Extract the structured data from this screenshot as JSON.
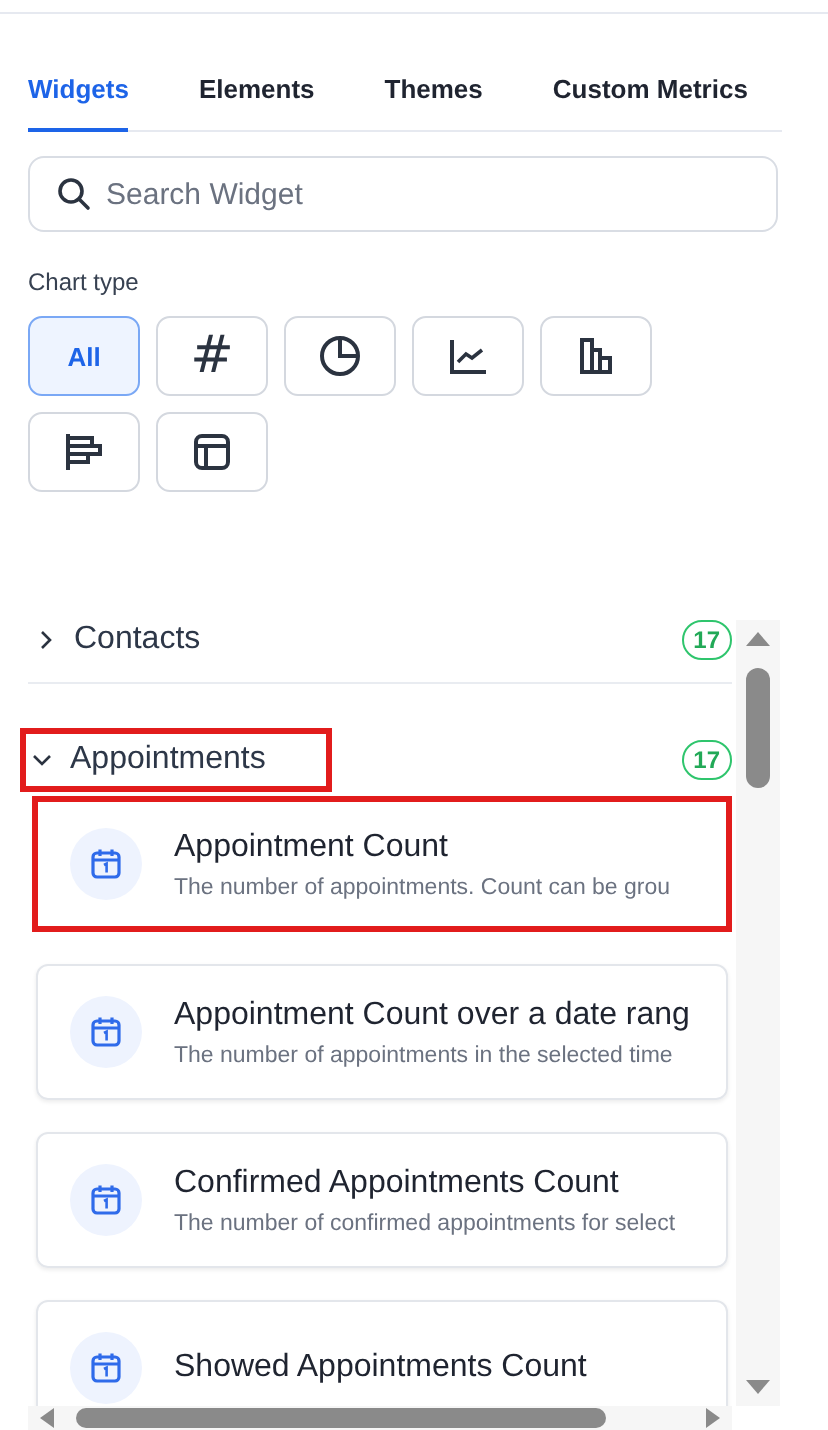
{
  "tabs": [
    {
      "label": "Widgets",
      "selected": true
    },
    {
      "label": "Elements",
      "selected": false
    },
    {
      "label": "Themes",
      "selected": false
    },
    {
      "label": "Custom Metrics",
      "selected": false
    }
  ],
  "search": {
    "placeholder": "Search Widget"
  },
  "chart_type": {
    "label": "Chart type",
    "options": [
      {
        "kind": "all",
        "label": "All",
        "selected": true
      },
      {
        "kind": "number",
        "label": "#",
        "selected": false
      },
      {
        "kind": "pie",
        "selected": false
      },
      {
        "kind": "line",
        "selected": false
      },
      {
        "kind": "bar",
        "selected": false
      },
      {
        "kind": "hbar",
        "selected": false
      },
      {
        "kind": "table",
        "selected": false
      }
    ]
  },
  "sections": [
    {
      "title": "Contacts",
      "count": "17",
      "expanded": false,
      "highlighted": false
    },
    {
      "title": "Appointments",
      "count": "17",
      "expanded": true,
      "highlighted": true,
      "widgets": [
        {
          "title": "Appointment Count",
          "description": "The number of appointments. Count can be grou",
          "highlighted": true
        },
        {
          "title": "Appointment Count over a date rang",
          "description": "The number of appointments in the selected time",
          "highlighted": false
        },
        {
          "title": "Confirmed Appointments Count",
          "description": "The number of confirmed appointments for select",
          "highlighted": false
        },
        {
          "title": "Showed Appointments Count",
          "highlighted": false
        }
      ]
    }
  ]
}
